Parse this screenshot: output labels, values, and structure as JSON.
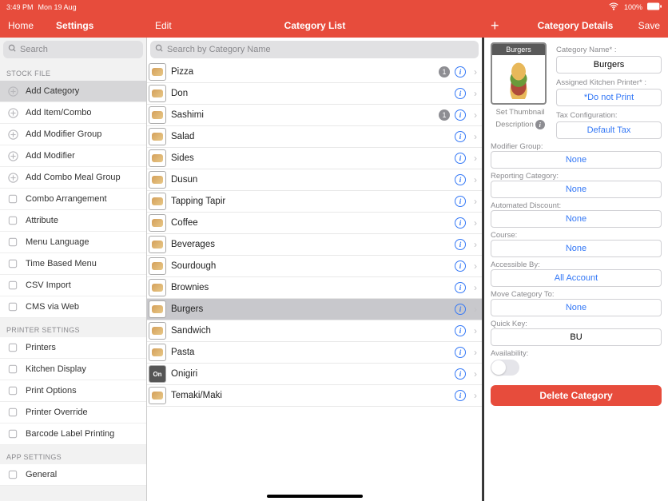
{
  "status": {
    "time": "3:49 PM",
    "date": "Mon 19 Aug",
    "wifi": "wifi",
    "battery_pct": "100%"
  },
  "topbar": {
    "home": "Home",
    "settings": "Settings",
    "edit": "Edit",
    "center_title": "Category List",
    "right_title": "Category Details",
    "save": "Save"
  },
  "sidebar": {
    "search_placeholder": "Search",
    "section_stock": "STOCK FILE",
    "stock_items": [
      "Add Category",
      "Add Item/Combo",
      "Add Modifier Group",
      "Add Modifier",
      "Add Combo Meal Group",
      "Combo Arrangement",
      "Attribute",
      "Menu Language",
      "Time Based Menu",
      "CSV Import",
      "CMS via Web"
    ],
    "section_printer": "PRINTER SETTINGS",
    "printer_items": [
      "Printers",
      "Kitchen Display",
      "Print Options",
      "Printer Override",
      "Barcode Label Printing"
    ],
    "section_app": "APP SETTINGS",
    "app_items": [
      "General"
    ]
  },
  "center": {
    "search_placeholder": "Search by Category Name",
    "rows": [
      {
        "label": "Pizza",
        "badge": "1"
      },
      {
        "label": "Don"
      },
      {
        "label": "Sashimi",
        "badge": "1"
      },
      {
        "label": "Salad"
      },
      {
        "label": "Sides"
      },
      {
        "label": "Dusun"
      },
      {
        "label": "Tapping Tapir"
      },
      {
        "label": "Coffee"
      },
      {
        "label": "Beverages"
      },
      {
        "label": "Sourdough"
      },
      {
        "label": "Brownies"
      },
      {
        "label": "Burgers",
        "selected": true
      },
      {
        "label": "Sandwich"
      },
      {
        "label": "Pasta"
      },
      {
        "label": "Onigiri",
        "thumb_text": "On"
      },
      {
        "label": "Temaki/Maki"
      }
    ]
  },
  "details": {
    "thumb_label": "Burgers",
    "set_thumbnail": "Set Thumbnail",
    "description": "Description",
    "fields": {
      "category_name_label": "Category Name* :",
      "category_name_value": "Burgers",
      "printer_label": "Assigned Kitchen Printer* :",
      "printer_value": "*Do not Print",
      "tax_label": "Tax Configuration:",
      "tax_value": "Default Tax",
      "modgroup_label": "Modifier Group:",
      "modgroup_value": "None",
      "repcat_label": "Reporting Category:",
      "repcat_value": "None",
      "autodisc_label": "Automated Discount:",
      "autodisc_value": "None",
      "course_label": "Course:",
      "course_value": "None",
      "access_label": "Accessible By:",
      "access_value": "All Account",
      "move_label": "Move Category To:",
      "move_value": "None",
      "quickkey_label": "Quick Key:",
      "quickkey_value": "BU",
      "availability_label": "Availability:"
    },
    "delete": "Delete Category"
  }
}
